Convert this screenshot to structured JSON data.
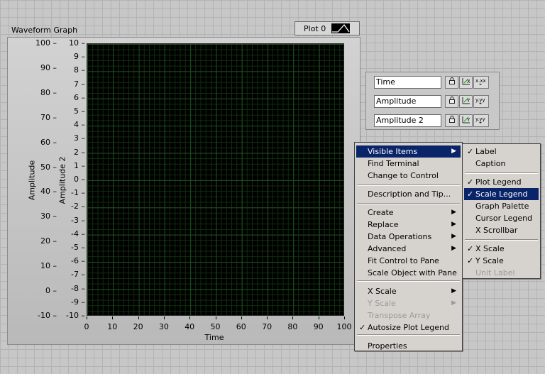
{
  "graph": {
    "label": "Waveform Graph",
    "plot_legend": {
      "name": "Plot 0"
    },
    "y_ticks": [
      "100",
      "90",
      "80",
      "70",
      "60",
      "50",
      "40",
      "30",
      "20",
      "10",
      "0",
      "-10"
    ],
    "y2_ticks": [
      "10",
      "9",
      "8",
      "7",
      "6",
      "5",
      "4",
      "3",
      "2",
      "1",
      "0",
      "-1",
      "-2",
      "-3",
      "-4",
      "-5",
      "-6",
      "-7",
      "-8",
      "-9",
      "-10"
    ],
    "x_ticks": [
      "0",
      "10",
      "20",
      "30",
      "40",
      "50",
      "60",
      "70",
      "80",
      "90",
      "100"
    ],
    "y_label": "Amplitude",
    "y2_label": "Amplitude 2",
    "x_label": "Time",
    "plot_bg": "#000000",
    "grid_color": "#1d4f1d"
  },
  "scale_legend": {
    "rows": [
      {
        "name": "Time"
      },
      {
        "name": "Amplitude"
      },
      {
        "name": "Amplitude 2"
      }
    ]
  },
  "context_menu": {
    "items": [
      {
        "label": "Visible Items",
        "submenu": true,
        "selected": true
      },
      {
        "label": "Find Terminal"
      },
      {
        "label": "Change to Control"
      },
      {
        "label": "Description and Tip..."
      },
      {
        "label": "Create",
        "submenu": true
      },
      {
        "label": "Replace",
        "submenu": true
      },
      {
        "label": "Data Operations",
        "submenu": true
      },
      {
        "label": "Advanced",
        "submenu": true
      },
      {
        "label": "Fit Control to Pane"
      },
      {
        "label": "Scale Object with Pane"
      },
      {
        "label": "X Scale",
        "submenu": true
      },
      {
        "label": "Y Scale",
        "submenu": true,
        "disabled": true
      },
      {
        "label": "Transpose Array",
        "disabled": true
      },
      {
        "label": "Autosize Plot Legend",
        "checked": true
      },
      {
        "label": "Properties"
      }
    ]
  },
  "visible_items_menu": {
    "items": [
      {
        "label": "Label",
        "checked": true
      },
      {
        "label": "Caption"
      },
      {
        "label": "Plot Legend",
        "checked": true
      },
      {
        "label": "Scale Legend",
        "checked": true,
        "selected": true
      },
      {
        "label": "Graph Palette"
      },
      {
        "label": "Cursor Legend"
      },
      {
        "label": "X Scrollbar"
      },
      {
        "label": "X Scale",
        "checked": true
      },
      {
        "label": "Y Scale",
        "checked": true
      },
      {
        "label": "Unit Label",
        "disabled": true
      }
    ]
  },
  "icons": {
    "lock": "lock-icon",
    "autoscale": "autoscale-icon",
    "format": "format-icon",
    "submenu": "submenu-arrow-icon",
    "check": "check-icon"
  }
}
